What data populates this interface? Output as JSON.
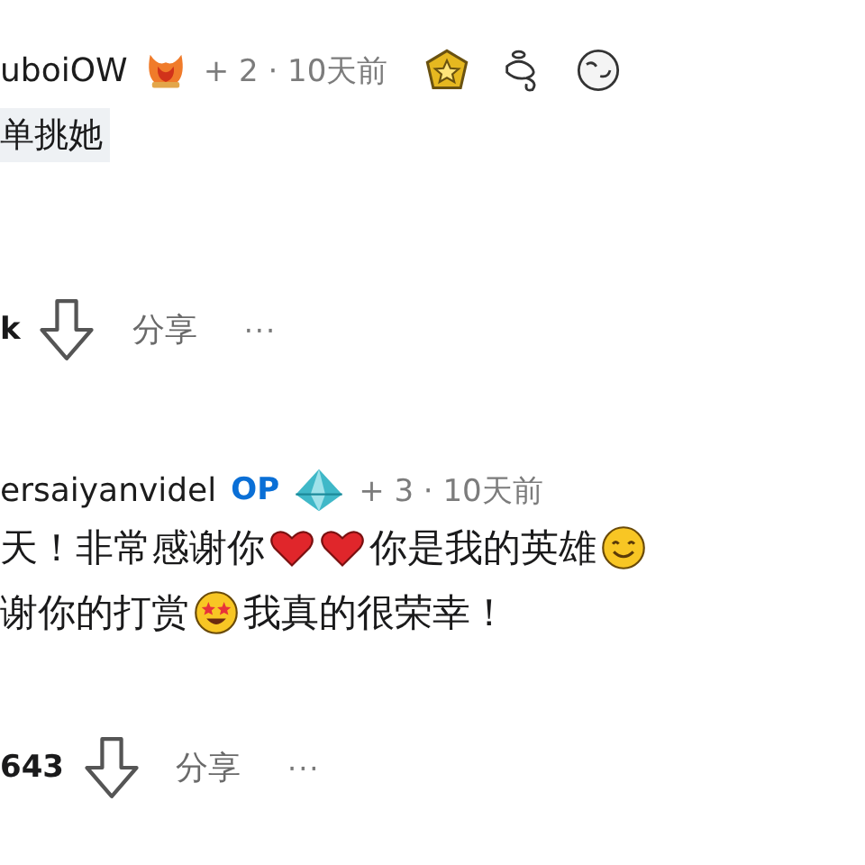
{
  "comments": [
    {
      "author": "uboiOW",
      "flair": {
        "kind": "flame"
      },
      "meta": "+ 2 · 10天前",
      "awards": [
        {
          "kind": "star-medal"
        },
        {
          "kind": "swirl"
        },
        {
          "kind": "face"
        }
      ],
      "tag": "单挑她",
      "votes": "k",
      "share": "分享",
      "more": "···"
    },
    {
      "author": "ersaiyanvidel",
      "op": "OP",
      "flair": {
        "kind": "crystal"
      },
      "meta": "+ 3 · 10天前",
      "lines": [
        [
          {
            "kind": "text",
            "text": "天！非常感谢你"
          },
          {
            "kind": "heart"
          },
          {
            "kind": "heart"
          },
          {
            "kind": "text",
            "text": "你是我的英雄"
          },
          {
            "kind": "smile"
          }
        ],
        [
          {
            "kind": "text",
            "text": "谢你的打赏"
          },
          {
            "kind": "starstruck"
          },
          {
            "kind": "text",
            "text": "我真的很荣幸！"
          }
        ]
      ],
      "votes": "643",
      "share": "分享",
      "more": "···"
    }
  ]
}
